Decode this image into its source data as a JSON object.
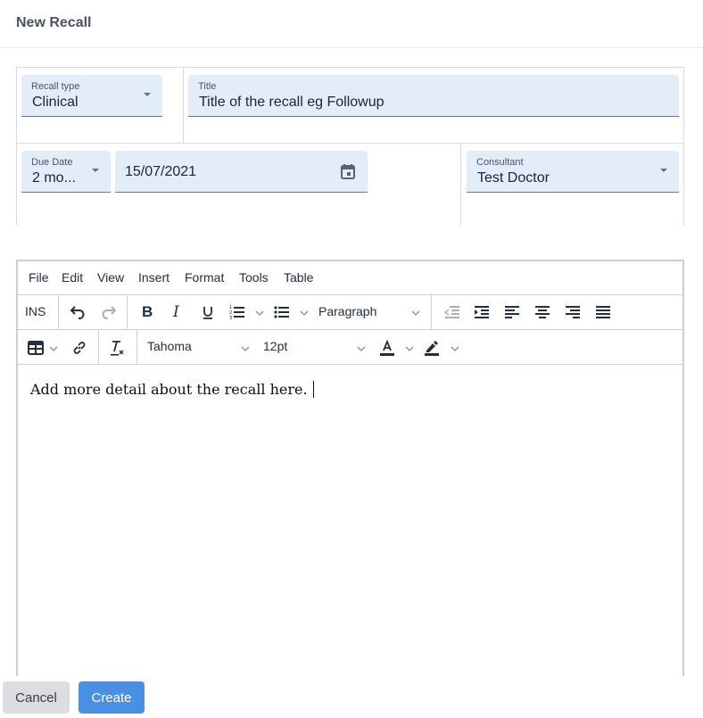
{
  "header": {
    "title": "New Recall"
  },
  "form": {
    "recall_type": {
      "label": "Recall type",
      "value": "Clinical"
    },
    "title": {
      "label": "Title",
      "value": "Title of the recall eg Followup"
    },
    "due_date": {
      "label": "Due Date",
      "value": "2 mo..."
    },
    "date": {
      "value": "15/07/2021"
    },
    "consultant": {
      "label": "Consultant",
      "value": "Test Doctor"
    }
  },
  "editor": {
    "menu": [
      "File",
      "Edit",
      "View",
      "Insert",
      "Format",
      "Tools",
      "Table"
    ],
    "toolbar": {
      "ins_label": "INS",
      "block_format": "Paragraph",
      "font_family": "Tahoma",
      "font_size": "12pt"
    },
    "content": "Add more detail about the recall here."
  },
  "actions": {
    "cancel_label": "Cancel",
    "create_label": "Create"
  },
  "colors": {
    "field_bg": "#e3edf9",
    "primary": "#4a90e2",
    "secondary": "#dcdde1"
  }
}
